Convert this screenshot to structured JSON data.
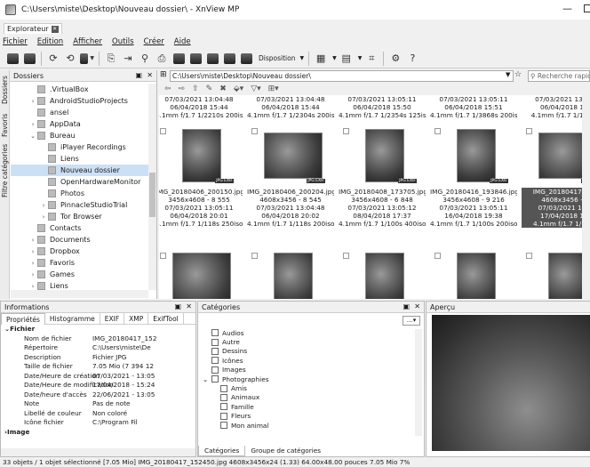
{
  "window": {
    "title": "C:\\Users\\miste\\Desktop\\Nouveau dossier\\ - XnView MP"
  },
  "tabs": [
    {
      "label": "Explorateur"
    }
  ],
  "menu": [
    "Fichier",
    "Edition",
    "Afficher",
    "Outils",
    "Créer",
    "Aide"
  ],
  "toolbar": {
    "disposition_label": "Disposition"
  },
  "left_panel": {
    "title": "Dossiers",
    "side_tabs": [
      "Dossiers",
      "Favoris",
      "Filtre catégories"
    ],
    "tree": [
      {
        "label": ".VirtualBox",
        "indent": 2,
        "arrow": ""
      },
      {
        "label": "AndroidStudioProjects",
        "indent": 2,
        "arrow": ">"
      },
      {
        "label": "ansel",
        "indent": 2,
        "arrow": ""
      },
      {
        "label": "AppData",
        "indent": 2,
        "arrow": ">"
      },
      {
        "label": "Bureau",
        "indent": 2,
        "arrow": "v"
      },
      {
        "label": "iPlayer Recordings",
        "indent": 3,
        "arrow": ""
      },
      {
        "label": "Liens",
        "indent": 3,
        "arrow": ""
      },
      {
        "label": "Nouveau dossier",
        "indent": 3,
        "arrow": "",
        "selected": true
      },
      {
        "label": "OpenHardwareMonitor",
        "indent": 3,
        "arrow": ""
      },
      {
        "label": "Photos",
        "indent": 3,
        "arrow": ""
      },
      {
        "label": "PinnacleStudioTrial",
        "indent": 3,
        "arrow": ">"
      },
      {
        "label": "Tor Browser",
        "indent": 3,
        "arrow": ">"
      },
      {
        "label": "Contacts",
        "indent": 2,
        "arrow": ""
      },
      {
        "label": "Documents",
        "indent": 2,
        "arrow": ">"
      },
      {
        "label": "Dropbox",
        "indent": 2,
        "arrow": ">"
      },
      {
        "label": "Favoris",
        "indent": 2,
        "arrow": ">"
      },
      {
        "label": "Games",
        "indent": 2,
        "arrow": ">"
      },
      {
        "label": "Liens",
        "indent": 2,
        "arrow": ">"
      }
    ]
  },
  "address": {
    "path": "C:\\Users\\miste\\Desktop\\Nouveau dossier\\",
    "search_placeholder": "Recherche rapide"
  },
  "grid": {
    "top_row": [
      {
        "l1": "07/03/2021 13:04:48",
        "l2": "06/04/2018 15:44",
        "l3": "4.1mm f/1.7 1/2210s 200iso"
      },
      {
        "l1": "07/03/2021 13:04:48",
        "l2": "06/04/2018 15:44",
        "l3": "4.1mm f/1.7 1/2304s 200iso"
      },
      {
        "l1": "07/03/2021 13:05:11",
        "l2": "06/04/2018 15:50",
        "l3": "4.1mm f/1.7 1/2354s 125iso"
      },
      {
        "l1": "07/03/2021 13:05:11",
        "l2": "06/04/2018 15:51",
        "l3": "4.1mm f/1.7 1/3868s 200iso"
      },
      {
        "l1": "07/03/2021 13:05:",
        "l2": "06/04/2018 15:",
        "l3": "4.1mm f/1.7 1/1747s"
      }
    ],
    "mid_row": [
      {
        "name": "IMG_20180406_200150.jpg",
        "dims": "3456x4608 - 8 555",
        "d1": "07/03/2021 13:05:11",
        "d2": "06/04/2018 20:01",
        "exif": "4.1mm f/1.7 1/118s 250iso",
        "selected": false
      },
      {
        "name": "IMG_20180406_200204.jpg",
        "dims": "4608x3456 - 8 545",
        "d1": "07/03/2021 13:04:48",
        "d2": "06/04/2018 20:02",
        "exif": "4.1mm f/1.7 1/118s 200iso",
        "selected": false
      },
      {
        "name": "IMG_20180408_173705.jpg",
        "dims": "3456x4608 - 6 848",
        "d1": "07/03/2021 13:05:12",
        "d2": "08/04/2018 17:37",
        "exif": "4.1mm f/1.7 1/100s 400iso",
        "selected": false
      },
      {
        "name": "IMG_20180416_193846.jpg",
        "dims": "3456x4608 - 9 216",
        "d1": "07/03/2021 13:05:11",
        "d2": "16/04/2018 19:38",
        "exif": "4.1mm f/1.7 1/100s 200iso",
        "selected": false
      },
      {
        "name": "IMG_20180417_152",
        "dims": "4608x3456 - 7",
        "d1": "07/03/2021 13:0",
        "d2": "17/04/2018 15:",
        "exif": "4.1mm f/1.7 1/157s",
        "selected": true
      }
    ],
    "badge": "JPG EXIF"
  },
  "info_panel": {
    "title": "Informations",
    "tabs": [
      "Propriétés",
      "Histogramme",
      "EXIF",
      "XMP",
      "ExifTool"
    ],
    "section": "Fichier",
    "props": [
      {
        "k": "Nom de fichier",
        "v": "IMG_20180417_152"
      },
      {
        "k": "Répertoire",
        "v": "C:\\Users\\miste\\De"
      },
      {
        "k": "Description",
        "v": "Fichier JPG"
      },
      {
        "k": "Taille de fichier",
        "v": "7.05 Mio (7 394 12"
      },
      {
        "k": "Date/Heure de création",
        "v": "07/03/2021 - 13:05"
      },
      {
        "k": "Date/Heure de modification",
        "v": "17/04/2018 - 15:24"
      },
      {
        "k": "Date/heure d'accès",
        "v": "22/06/2021 - 13:05"
      },
      {
        "k": "Note",
        "v": "Pas de note"
      },
      {
        "k": "Libellé de couleur",
        "v": "Non coloré"
      },
      {
        "k": "Icône fichier",
        "v": "C:\\Program Fil"
      }
    ],
    "next_section": "Image"
  },
  "cat_panel": {
    "title": "Catégories",
    "items": [
      {
        "label": "Audios",
        "indent": 0,
        "arrow": ""
      },
      {
        "label": "Autre",
        "indent": 0,
        "arrow": ""
      },
      {
        "label": "Dessins",
        "indent": 0,
        "arrow": ""
      },
      {
        "label": "Icônes",
        "indent": 0,
        "arrow": ""
      },
      {
        "label": "Images",
        "indent": 0,
        "arrow": ""
      },
      {
        "label": "Photographies",
        "indent": 0,
        "arrow": "v"
      },
      {
        "label": "Amis",
        "indent": 1,
        "arrow": ""
      },
      {
        "label": "Animaux",
        "indent": 1,
        "arrow": ""
      },
      {
        "label": "Famille",
        "indent": 1,
        "arrow": ""
      },
      {
        "label": "Fleurs",
        "indent": 1,
        "arrow": ""
      },
      {
        "label": "Mon animal",
        "indent": 1,
        "arrow": ""
      }
    ],
    "bottom_tabs": [
      "Catégories",
      "Groupe de catégories"
    ]
  },
  "preview_panel": {
    "title": "Aperçu"
  },
  "status": "33 objets / 1 objet sélectionné [7.05 Mio]  IMG_20180417_152450.jpg  4608x3456x24 (1.33)  64.00x48.00 pouces  7.05 Mio  7%"
}
